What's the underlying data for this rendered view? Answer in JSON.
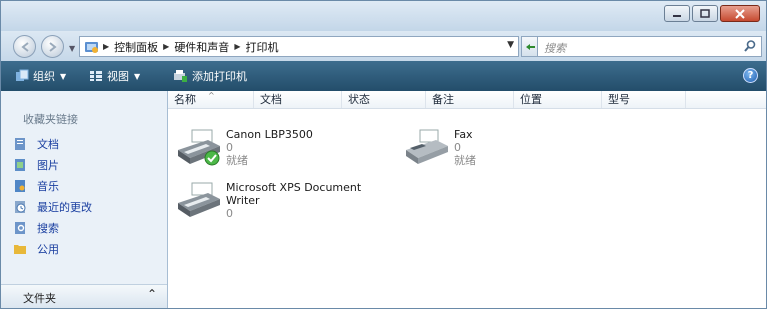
{
  "window_buttons": {
    "minimize": "minimize-icon",
    "maximize": "maximize-icon",
    "close": "close-icon"
  },
  "breadcrumbs": [
    "控制面板",
    "硬件和声音",
    "打印机"
  ],
  "search": {
    "placeholder": "搜索"
  },
  "toolbar": {
    "organize": "组织",
    "views": "视图",
    "add_printer": "添加打印机"
  },
  "sidebar": {
    "favorites_title": "收藏夹链接",
    "items": [
      {
        "label": "文档",
        "icon": "documents-icon"
      },
      {
        "label": "图片",
        "icon": "pictures-icon"
      },
      {
        "label": "音乐",
        "icon": "music-icon"
      },
      {
        "label": "最近的更改",
        "icon": "recent-changes-icon"
      },
      {
        "label": "搜索",
        "icon": "searches-icon"
      },
      {
        "label": "公用",
        "icon": "public-folder-icon"
      }
    ],
    "folders_label": "文件夹"
  },
  "columns": [
    "名称",
    "文档",
    "状态",
    "备注",
    "位置",
    "型号"
  ],
  "printers": [
    {
      "name": "Canon LBP3500",
      "docs": "0",
      "status": "就绪",
      "default": true
    },
    {
      "name": "Fax",
      "docs": "0",
      "status": "就绪",
      "default": false
    },
    {
      "name_line1": "Microsoft XPS Document",
      "name_line2": "Writer",
      "docs": "0",
      "default": false
    }
  ]
}
